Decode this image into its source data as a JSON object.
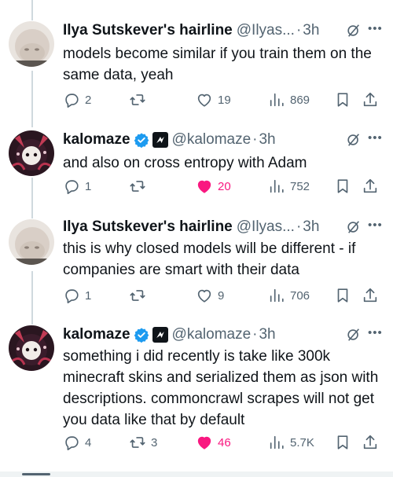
{
  "tweets": [
    {
      "name": "Ilya Sutskever's hairline",
      "handle": "@Ilyas...",
      "dot": "·",
      "time": "3h",
      "text": "models become similar if you train them on the same data, yeah",
      "verified": false,
      "replies": "2",
      "reposts": "",
      "likes": "19",
      "liked": false,
      "views": "869"
    },
    {
      "name": "kalomaze",
      "handle": "@kalomaze",
      "dot": "·",
      "time": "3h",
      "text": "and also on cross entropy with Adam",
      "verified": true,
      "replies": "1",
      "reposts": "",
      "likes": "20",
      "liked": true,
      "views": "752"
    },
    {
      "name": "Ilya Sutskever's hairline",
      "handle": "@Ilyas...",
      "dot": "·",
      "time": "3h",
      "text": "this is why closed models will be different - if companies are smart with their data",
      "verified": false,
      "replies": "1",
      "reposts": "",
      "likes": "9",
      "liked": false,
      "views": "706"
    },
    {
      "name": "kalomaze",
      "handle": "@kalomaze",
      "dot": "·",
      "time": "3h",
      "text": "something i did recently is take like 300k minecraft skins and serialized them as json with descriptions. commoncrawl scrapes will not get you data like that by default",
      "verified": true,
      "replies": "4",
      "reposts": "3",
      "likes": "46",
      "liked": true,
      "views": "5.7K"
    }
  ],
  "icons": {
    "reply": "reply-icon",
    "repost": "repost-icon",
    "like": "heart-icon",
    "views": "views-icon",
    "bookmark": "bookmark-icon",
    "share": "share-icon",
    "grok": "grok-icon",
    "more": "more-icon"
  },
  "colors": {
    "text": "#0f1419",
    "secondary": "#536471",
    "like": "#f91880",
    "verified": "#1d9bf0",
    "thread_line": "#cfd9de"
  }
}
